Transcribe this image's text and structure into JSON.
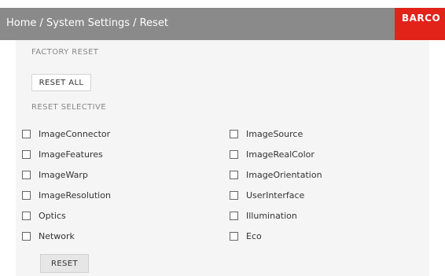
{
  "header": {
    "breadcrumb": "Home / System Settings / Reset",
    "logo_text": "BARCO",
    "bg_color": "#8a8a8a",
    "logo_color": "#e2231a"
  },
  "factory_reset": {
    "title": "FACTORY RESET",
    "button_label": "RESET ALL"
  },
  "reset_selective": {
    "title": "RESET SELECTIVE",
    "left_options": [
      "ImageConnector",
      "ImageFeatures",
      "ImageWarp",
      "ImageResolution",
      "Optics",
      "Network"
    ],
    "right_options": [
      "ImageSource",
      "ImageRealColor",
      "ImageOrientation",
      "UserInterface",
      "Illumination",
      "Eco"
    ],
    "button_label": "RESET"
  }
}
